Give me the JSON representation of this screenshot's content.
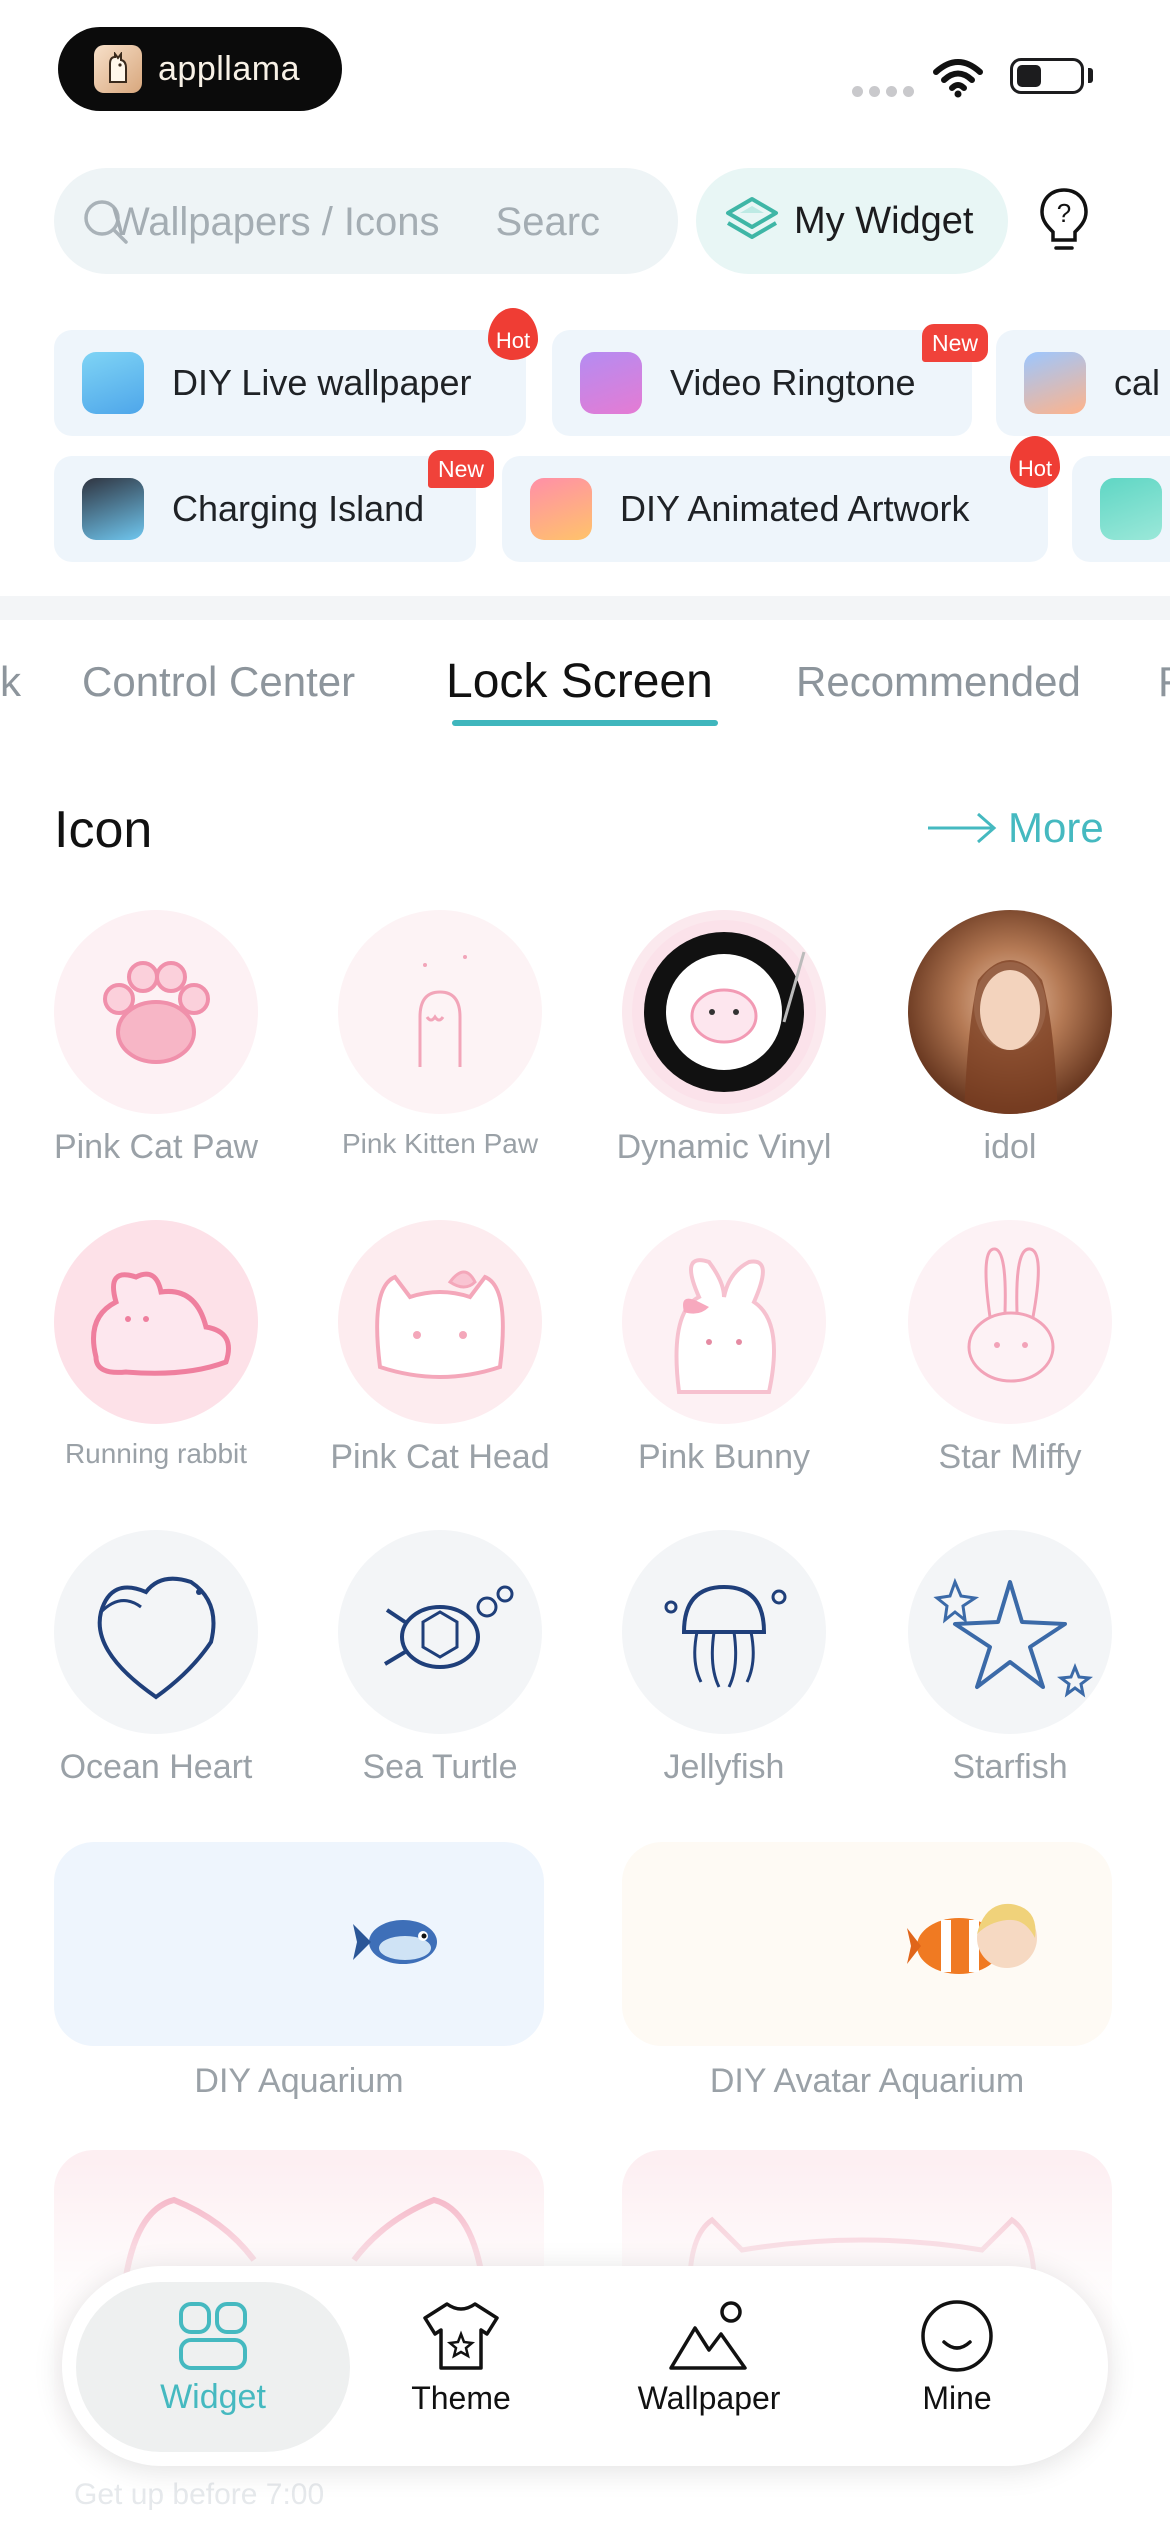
{
  "status_bar": {
    "logo_text": "appllama"
  },
  "search": {
    "text_a": "Wallpapers / Icons",
    "text_b": "Searc"
  },
  "header": {
    "my_widget_label": "My Widget"
  },
  "features": {
    "row1": [
      {
        "label": "DIY Live wallpaper",
        "badge": "Hot"
      },
      {
        "label": "Video Ringtone",
        "badge": "New"
      },
      {
        "label": "cal",
        "badge": ""
      }
    ],
    "row2": [
      {
        "label": "Charging Island",
        "badge": "New"
      },
      {
        "label": "DIY Animated Artwork",
        "badge": "Hot"
      }
    ]
  },
  "tabs": {
    "prev_partial": "k",
    "items": [
      "Control Center",
      "Lock Screen",
      "Recommended"
    ],
    "next_partial": "F",
    "active": "Lock Screen"
  },
  "section": {
    "title": "Icon",
    "more_label": "More"
  },
  "icons": [
    {
      "label": "Pink Cat Paw"
    },
    {
      "label": "Pink Kitten Paw"
    },
    {
      "label": "Dynamic Vinyl"
    },
    {
      "label": "idol"
    },
    {
      "label": "Running rabbit"
    },
    {
      "label": "Pink Cat Head"
    },
    {
      "label": "Pink Bunny"
    },
    {
      "label": "Star Miffy"
    },
    {
      "label": "Ocean Heart"
    },
    {
      "label": "Sea Turtle"
    },
    {
      "label": "Jellyfish"
    },
    {
      "label": "Starfish"
    }
  ],
  "cards": [
    {
      "label": "DIY Aquarium"
    },
    {
      "label": "DIY Avatar Aquarium"
    }
  ],
  "bottom_nav": {
    "items": [
      {
        "label": "Widget",
        "icon": "widget-grid-icon"
      },
      {
        "label": "Theme",
        "icon": "tshirt-icon"
      },
      {
        "label": "Wallpaper",
        "icon": "mountain-sun-icon"
      },
      {
        "label": "Mine",
        "icon": "smile-icon"
      }
    ],
    "active": "Widget"
  },
  "ghost_text": "Get up before 7:00",
  "colors": {
    "accent": "#45b9c0",
    "badge_red": "#f0423a",
    "pink": "#f49bb5",
    "navy": "#1f3f7a"
  }
}
